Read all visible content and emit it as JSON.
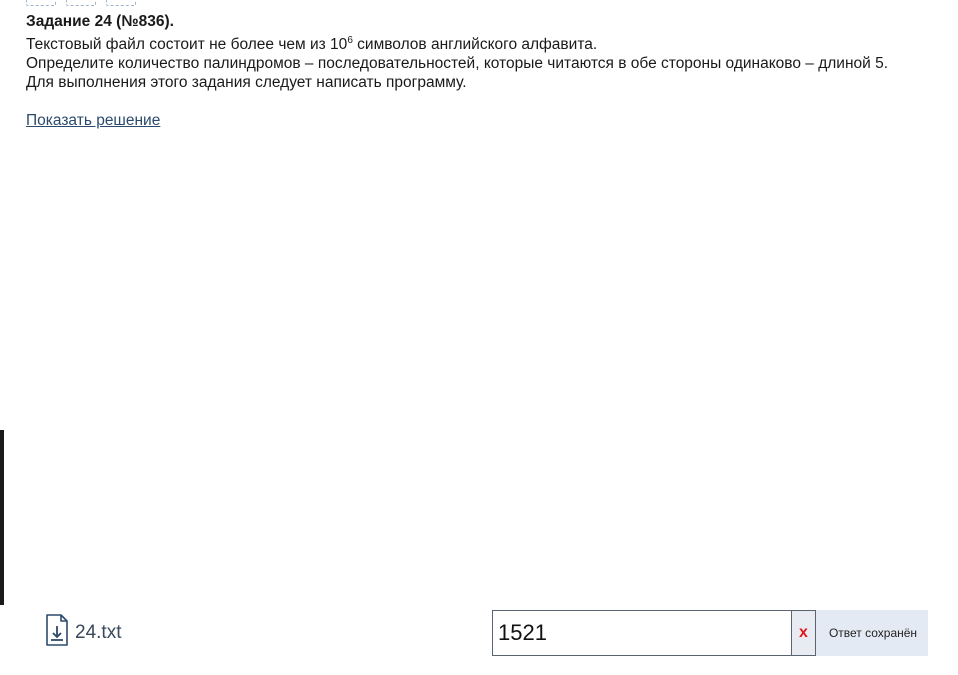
{
  "task": {
    "title": "Задание 24 (№836).",
    "line1_before_sup": "Текстовый файл состоит не более чем из 10",
    "line1_sup": "6",
    "line1_after_sup": " символов английского алфавита.",
    "line2": "Определите количество палиндромов – последовательностей, которые читаются в обе стороны одинаково – длиной 5.",
    "line3": "Для выполнения этого задания следует написать программу.",
    "show_solution_label": "Показать решение"
  },
  "file": {
    "name": "24.txt",
    "icon": "file-download-icon"
  },
  "answer": {
    "value": "1521",
    "clear_label": "x",
    "status": "Ответ сохранён"
  },
  "colors": {
    "link": "#2c4a6b",
    "clear": "#e01818",
    "status_bg": "#e4eaf3"
  }
}
